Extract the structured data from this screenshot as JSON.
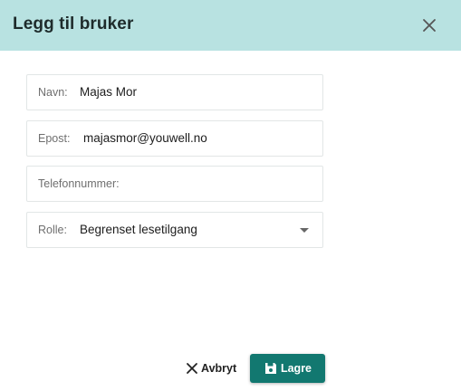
{
  "dialog": {
    "title": "Legg til bruker",
    "header_color": "#b8e2e1",
    "close_icon": "close-icon"
  },
  "form": {
    "name": {
      "label": "Navn:",
      "value": "Majas Mor"
    },
    "email": {
      "label": "Epost:",
      "value": "majasmor@youwell.no"
    },
    "phone": {
      "label": "Telefonnummer:",
      "value": ""
    },
    "role": {
      "label": "Rolle:",
      "value": "Begrenset lesetilgang"
    }
  },
  "actions": {
    "cancel_label": "Avbryt",
    "cancel_icon": "close-icon",
    "save_label": "Lagre",
    "save_icon": "save-icon",
    "save_color": "#127870"
  }
}
